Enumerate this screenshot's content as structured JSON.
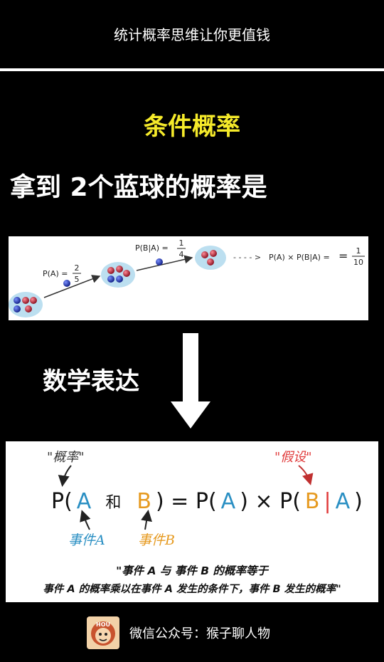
{
  "banner": {
    "title": "统计概率思维让你更值钱"
  },
  "section": {
    "title": "条件概率"
  },
  "headline": "拿到 2个蓝球的概率是",
  "diagram1": {
    "pa_label": "P(A) =",
    "pa_num": "2",
    "pa_den": "5",
    "pba_label": "P(B|A) =",
    "pba_num": "1",
    "pba_den": "4",
    "dashes": "- - - - >",
    "result_label": "P(A) × P(B|A) =",
    "result_num": "1",
    "result_den": "10"
  },
  "math_label": "数学表达",
  "diagram2": {
    "note_probability": "\"概率\"",
    "note_assumption": "\"假设\"",
    "formula": {
      "p_open": "P(",
      "a1": "A",
      "and": "和",
      "b1": "B",
      "eq": ") = P(",
      "a2": "A",
      "close_times": ") × P(",
      "b2": "B",
      "bar": "|",
      "a3": "A",
      "close": ")"
    },
    "event_a": "事件A",
    "event_b": "事件B",
    "caption_line1": "\"事件 A 与 事件 B 的概率等于",
    "caption_line2": "事件 A 的概率乘以在事件 A 发生的条件下，事件 B 发生的概率\""
  },
  "footer": {
    "avatar_text": "HOU",
    "text": "微信公众号：猴子聊人物"
  },
  "colors": {
    "title_yellow": "#f5ea2a",
    "event_a_blue": "#2a8fc3",
    "event_b_orange": "#e69a20",
    "assumption_red": "#e03a3a",
    "ball_blue": "#1f3fb8",
    "ball_red": "#c8283a"
  }
}
